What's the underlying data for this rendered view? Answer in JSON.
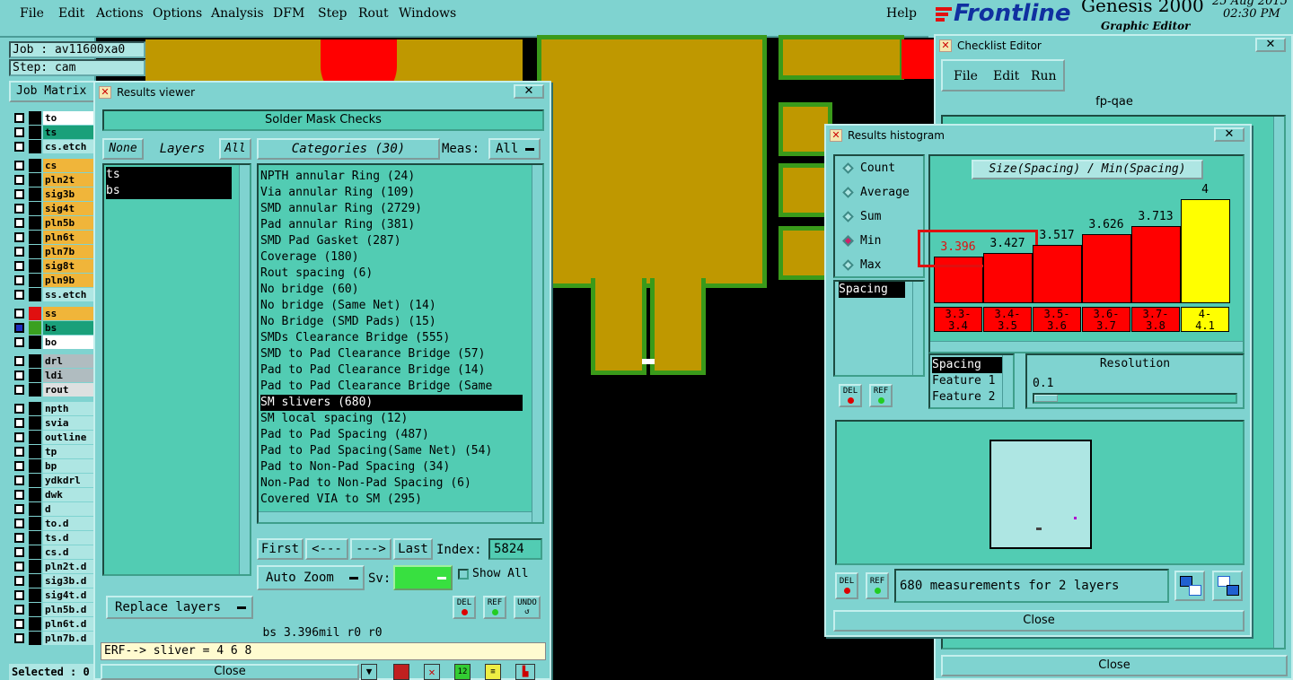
{
  "menu": [
    "File",
    "Edit",
    "Actions",
    "Options",
    "Analysis",
    "DFM",
    "Step",
    "Rout",
    "Windows",
    "Help"
  ],
  "brand": {
    "logo": "Frontline",
    "product": "Genesis 2000",
    "subtitle": "Graphic Editor",
    "date": "25 Aug 2015",
    "time": "02:30 PM"
  },
  "job": {
    "job": "Job : av11600xa0",
    "step": "Step: cam",
    "matrix": "Job Matrix",
    "selected": "Selected : 0"
  },
  "layers": [
    {
      "name": "to",
      "color": "#ffffff"
    },
    {
      "name": "ts",
      "color": "#1aa07a"
    },
    {
      "name": "cs.etch",
      "color": "#aee6e3"
    },
    {
      "name": "cs",
      "color": "#f0b53a"
    },
    {
      "name": "pln2t",
      "color": "#f0b53a"
    },
    {
      "name": "sig3b",
      "color": "#f0b53a"
    },
    {
      "name": "sig4t",
      "color": "#f0b53a"
    },
    {
      "name": "pln5b",
      "color": "#f0b53a"
    },
    {
      "name": "pln6t",
      "color": "#f0b53a"
    },
    {
      "name": "pln7b",
      "color": "#f0b53a"
    },
    {
      "name": "sig8t",
      "color": "#f0b53a"
    },
    {
      "name": "pln9b",
      "color": "#f0b53a"
    },
    {
      "name": "ss.etch",
      "color": "#aee6e3"
    },
    {
      "name": "ss",
      "color": "#f0b53a"
    },
    {
      "name": "bs",
      "color": "#1aa07a"
    },
    {
      "name": "bo",
      "color": "#ffffff"
    },
    {
      "name": "drl",
      "color": "#b0bcc0"
    },
    {
      "name": "ldi",
      "color": "#b0bcc0"
    },
    {
      "name": "rout",
      "color": "#dde0e0"
    },
    {
      "name": "npth",
      "color": "#aee6e3"
    },
    {
      "name": "svia",
      "color": "#aee6e3"
    },
    {
      "name": "outline",
      "color": "#aee6e3"
    },
    {
      "name": "tp",
      "color": "#aee6e3"
    },
    {
      "name": "bp",
      "color": "#aee6e3"
    },
    {
      "name": "ydkdrl",
      "color": "#aee6e3"
    },
    {
      "name": "dwk",
      "color": "#aee6e3"
    },
    {
      "name": "d",
      "color": "#aee6e3"
    },
    {
      "name": "to.d",
      "color": "#aee6e3"
    },
    {
      "name": "ts.d",
      "color": "#aee6e3"
    },
    {
      "name": "cs.d",
      "color": "#aee6e3"
    },
    {
      "name": "pln2t.d",
      "color": "#aee6e3"
    },
    {
      "name": "sig3b.d",
      "color": "#aee6e3"
    },
    {
      "name": "sig4t.d",
      "color": "#aee6e3"
    },
    {
      "name": "pln5b.d",
      "color": "#aee6e3"
    },
    {
      "name": "pln6t.d",
      "color": "#aee6e3"
    },
    {
      "name": "pln7b.d",
      "color": "#aee6e3"
    }
  ],
  "results_viewer": {
    "title": "Results viewer",
    "header": "Solder Mask Checks",
    "none": "None",
    "layers_label": "Layers",
    "all": "All",
    "layer_items": [
      "ts",
      "bs"
    ],
    "categories_label": "Categories (30)",
    "meas_label": "Meas:",
    "meas_value": "All",
    "categories": [
      "NPTH annular Ring (24)",
      "Via annular Ring (109)",
      "SMD annular Ring (2729)",
      "Pad annular Ring (381)",
      "SMD Pad Gasket (287)",
      "Coverage (180)",
      "Rout spacing (6)",
      "No bridge (60)",
      "No bridge (Same Net) (14)",
      "No Bridge (SMD Pads) (15)",
      "SMDs Clearance Bridge (555)",
      "SMD to Pad Clearance Bridge (57)",
      "Pad to Pad Clearance Bridge (14)",
      "Pad to Pad Clearance Bridge (Same",
      "SM slivers (680)",
      "SM local spacing (12)",
      "Pad to Pad Spacing (487)",
      "Pad to Pad Spacing(Same Net) (54)",
      "Pad to Non-Pad Spacing (34)",
      "Non-Pad to Non-Pad Spacing (6)",
      "Covered VIA to SM (295)"
    ],
    "selected_index": 14,
    "first": "First",
    "prev": "<---",
    "next": "--->",
    "last": "Last",
    "index_label": "Index:",
    "index_value": "5824",
    "auto_zoom": "Auto Zoom",
    "sv_label": "Sv:",
    "show_all": "Show All",
    "replace_layers": "Replace layers",
    "del": "DEL",
    "ref": "REF",
    "undo": "UNDO",
    "status": "bs 3.396mil  r0  r0",
    "erf": "ERF--> sliver = 4 6 8",
    "close": "Close"
  },
  "checklist": {
    "title": "Checklist Editor",
    "menu": [
      "File",
      "Edit",
      "Run"
    ],
    "name": "fp-qae",
    "close": "Close"
  },
  "histogram": {
    "title": "Results histogram",
    "modes": [
      "Count",
      "Average",
      "Sum",
      "Min",
      "Max"
    ],
    "selected_mode": "Min",
    "chart_title": "Size(Spacing) / Min(Spacing)",
    "list": [
      "Spacing"
    ],
    "fields": [
      "Spacing",
      "Feature 1",
      "Feature 2"
    ],
    "resolution_label": "Resolution",
    "resolution_value": "0.1",
    "del": "DEL",
    "ref": "REF",
    "summary": "680 measurements for 2 layers",
    "close": "Close"
  },
  "chart_data": {
    "type": "bar",
    "title": "Size(Spacing) / Min(Spacing)",
    "categories": [
      "3.3-3.4",
      "3.4-3.5",
      "3.5-3.6",
      "3.6-3.7",
      "3.7-3.8",
      "4-4.1"
    ],
    "category_lines": [
      [
        "3.3-",
        "3.4"
      ],
      [
        "3.4-",
        "3.5"
      ],
      [
        "3.5-",
        "3.6"
      ],
      [
        "3.6-",
        "3.7"
      ],
      [
        "3.7-",
        "3.8"
      ],
      [
        "4-",
        "4.1"
      ]
    ],
    "values": [
      3.396,
      3.427,
      3.517,
      3.626,
      3.713,
      4
    ],
    "value_labels": [
      "3.396",
      "3.427",
      "3.517",
      "3.626",
      "3.713",
      "4"
    ],
    "bar_colors": [
      "#ff0000",
      "#ff0000",
      "#ff0000",
      "#ff0000",
      "#ff0000",
      "#ffff00"
    ],
    "ylim": [
      0,
      4
    ],
    "highlight": "3.396"
  }
}
